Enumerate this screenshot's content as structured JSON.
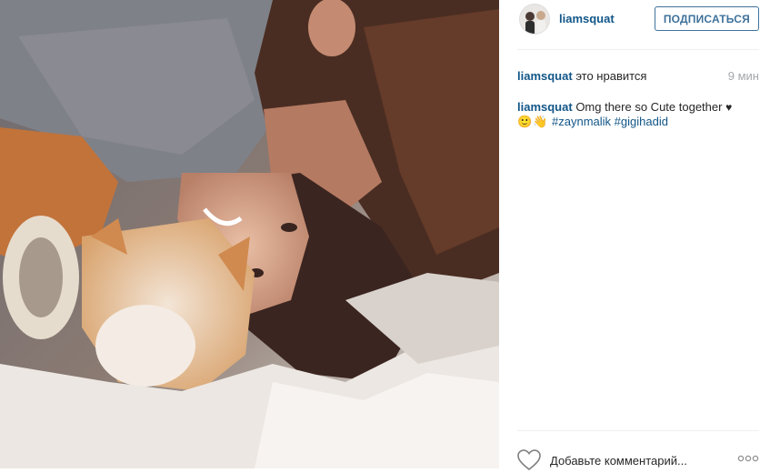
{
  "photo": {
    "alt_icon": "post-photo"
  },
  "header": {
    "username": "liamsquat",
    "follow_label": "ПОДПИСАТЬСЯ"
  },
  "likes": {
    "user": "liamsquat",
    "text": "это нравится",
    "time": "9 мин"
  },
  "caption": {
    "user": "liamsquat",
    "text": "Omg there so Cute together",
    "heart": "♥",
    "emoji": "🙂👋",
    "hashtags": [
      "#zaynmalik",
      "#gigihadid"
    ]
  },
  "footer": {
    "comment_placeholder": "Добавьте комментарий..."
  },
  "colors": {
    "link": "#125688",
    "follow": "#3f729b",
    "muted": "#a5a7aa",
    "divider": "#efefef"
  },
  "icons": {
    "like": "heart-outline-icon",
    "more": "ellipsis-icon"
  }
}
